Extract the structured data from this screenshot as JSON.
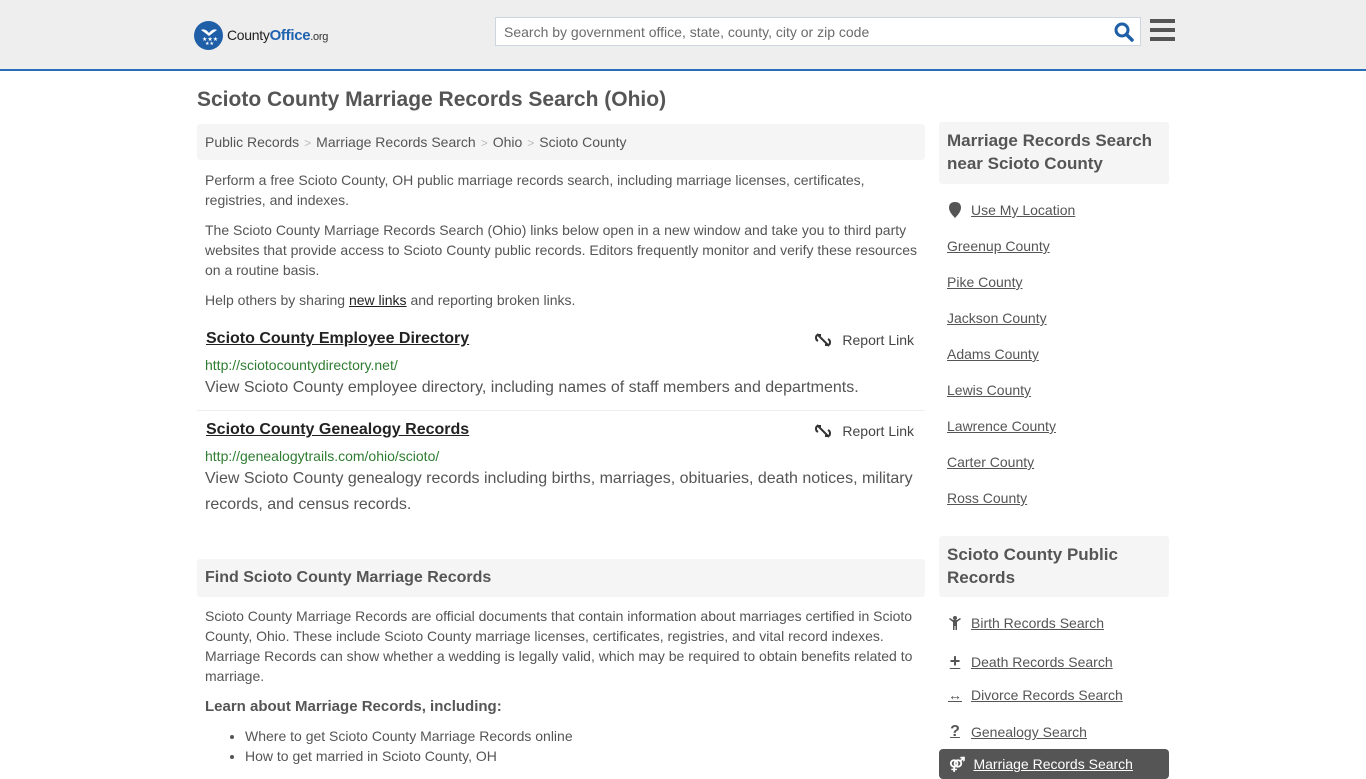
{
  "header": {
    "logo": {
      "part1": "County",
      "part2": "Office",
      "part3": ".org"
    },
    "search_placeholder": "Search by government office, state, county, city or zip code"
  },
  "page_title": "Scioto County Marriage Records Search (Ohio)",
  "breadcrumb": [
    "Public Records",
    "Marriage Records Search",
    "Ohio",
    "Scioto County"
  ],
  "intro": {
    "p1": "Perform a free Scioto County, OH public marriage records search, including marriage licenses, certificates, registries, and indexes.",
    "p2": "The Scioto County Marriage Records Search (Ohio) links below open in a new window and take you to third party websites that provide access to Scioto County public records. Editors frequently monitor and verify these resources on a routine basis.",
    "p3_before": "Help others by sharing ",
    "p3_link": "new links",
    "p3_after": " and reporting broken links."
  },
  "results": [
    {
      "title": "Scioto County Employee Directory",
      "url": "http://sciotocountydirectory.net/",
      "description": "View Scioto County employee directory, including names of staff members and departments.",
      "report_label": "Report Link"
    },
    {
      "title": "Scioto County Genealogy Records",
      "url": "http://genealogytrails.com/ohio/scioto/",
      "description": "View Scioto County genealogy records including births, marriages, obituaries, death notices, military records, and census records.",
      "report_label": "Report Link"
    }
  ],
  "find_section": {
    "heading": "Find Scioto County Marriage Records",
    "paragraph": "Scioto County Marriage Records are official documents that contain information about marriages certified in Scioto County, Ohio. These include Scioto County marriage licenses, certificates, registries, and vital record indexes. Marriage Records can show whether a wedding is legally valid, which may be required to obtain benefits related to marriage.",
    "learn_heading": "Learn about Marriage Records, including:",
    "learn_items": [
      "Where to get Scioto County Marriage Records online",
      "How to get married in Scioto County, OH"
    ]
  },
  "sidebar": {
    "nearby_heading": "Marriage Records Search near Scioto County",
    "use_location": "Use My Location",
    "nearby": [
      "Greenup County",
      "Pike County",
      "Jackson County",
      "Adams County",
      "Lewis County",
      "Lawrence County",
      "Carter County",
      "Ross County"
    ],
    "public_heading": "Scioto County Public Records",
    "public_links": [
      {
        "icon": "child-icon",
        "label": "Birth Records Search"
      },
      {
        "icon": "plus-icon",
        "label": "Death Records Search"
      },
      {
        "icon": "arrows-horizontal-icon",
        "label": "Divorce Records Search"
      },
      {
        "icon": "question-icon",
        "label": "Genealogy Search"
      }
    ],
    "active_link": {
      "icon": "venus-mars-icon",
      "label": "Marriage Records Search"
    }
  }
}
